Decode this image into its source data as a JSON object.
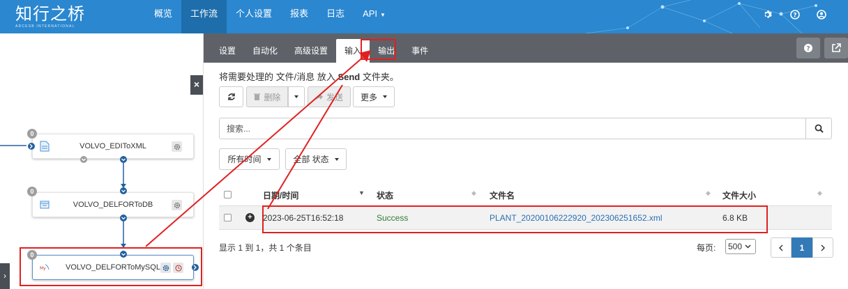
{
  "brand": {
    "name": "知行之桥",
    "tagline": "ARCESB INTERNATIONAL"
  },
  "nav": {
    "items": [
      {
        "label": "概览"
      },
      {
        "label": "工作流",
        "active": true
      },
      {
        "label": "个人设置"
      },
      {
        "label": "报表"
      },
      {
        "label": "日志"
      },
      {
        "label": "API"
      }
    ],
    "icons": [
      "gear-icon",
      "help-icon",
      "user-icon"
    ]
  },
  "flow": {
    "nodes": [
      {
        "label": "VOLVO_EDIToXML",
        "badge": "0",
        "icon": "file-icon"
      },
      {
        "label": "VOLVO_DELFORToDB",
        "badge": "0",
        "icon": "database-icon"
      },
      {
        "label": "VOLVO_DELFORToMySQL",
        "badge": "0",
        "icon": "mysql-icon",
        "selected": true
      }
    ],
    "close_label": "×",
    "expand_label": "›"
  },
  "panel": {
    "tabs": [
      {
        "label": "设置"
      },
      {
        "label": "自动化"
      },
      {
        "label": "高级设置"
      },
      {
        "label": "输入",
        "active": true
      },
      {
        "label": "输出"
      },
      {
        "label": "事件"
      }
    ],
    "hint_pre": "将需要处理的 文件/消息 放入 ",
    "hint_bold": "Send",
    "hint_post": " 文件夹。",
    "toolbar": {
      "delete_label": "删除",
      "send_label": "发送",
      "more_label": "更多"
    },
    "search": {
      "placeholder": "搜索..."
    },
    "filters": {
      "time_label": "所有时间",
      "status_label": "全部 状态"
    },
    "table": {
      "columns": [
        "日期/时间",
        "状态",
        "文件名",
        "文件大小"
      ],
      "rows": [
        {
          "datetime": "2023-06-25T16:52:18",
          "status": "Success",
          "filename": "PLANT_20200106222920_202306251652.xml",
          "size": "6.8 KB"
        }
      ]
    },
    "footer": {
      "summary": "显示 1 到 1，共 1 个条目",
      "per_page_label": "每页:",
      "per_page_value": "500",
      "page_current": "1"
    }
  },
  "colors": {
    "nav_bg": "#2a87d0",
    "nav_active": "#1e6eab",
    "panel_head": "#5e6268",
    "annotation_red": "#e02020",
    "success_green": "#2e7d32",
    "link_blue": "#2a6fb5"
  }
}
